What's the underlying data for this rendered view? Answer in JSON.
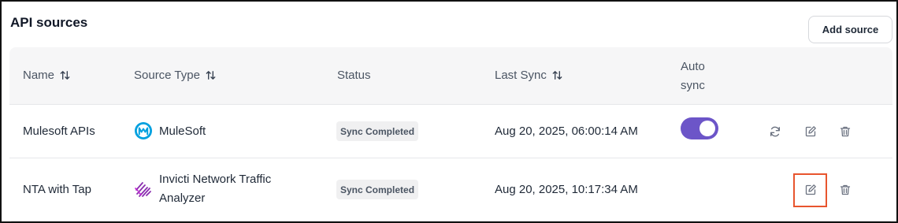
{
  "header": {
    "title": "API sources",
    "add_button_label": "Add source"
  },
  "table": {
    "columns": [
      {
        "label": "Name",
        "sortable": true
      },
      {
        "label": "Source Type",
        "sortable": true
      },
      {
        "label": "Status",
        "sortable": false
      },
      {
        "label": "Last Sync",
        "sortable": true
      },
      {
        "label": "Auto sync",
        "sortable": false
      }
    ],
    "rows": [
      {
        "name": "Mulesoft APIs",
        "source_type": "MuleSoft",
        "source_icon": "mulesoft-logo-icon",
        "status": "Sync Completed",
        "last_sync": "Aug 20, 2025, 06:00:14 AM",
        "auto_sync": true,
        "actions": [
          "sync-icon",
          "edit-icon",
          "delete-icon"
        ]
      },
      {
        "name": "NTA with Tap",
        "source_type_line1": "Invicti Network Traffic",
        "source_type_line2": "Analyzer",
        "source_icon": "invicti-nta-logo-icon",
        "status": "Sync Completed",
        "last_sync": "Aug 20, 2025, 10:17:34 AM",
        "auto_sync": null,
        "actions": [
          "edit-icon",
          "delete-icon"
        ]
      }
    ]
  },
  "colors": {
    "toggle_on": "#6c55c8",
    "mulesoft_blue": "#00a0df",
    "invicti_purple": "#8b2fb0",
    "highlight": "#e8552e"
  }
}
